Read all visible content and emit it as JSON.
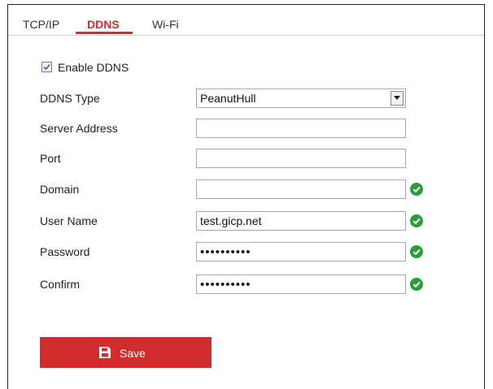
{
  "tabs": [
    {
      "label": "TCP/IP",
      "active": false
    },
    {
      "label": "DDNS",
      "active": true
    },
    {
      "label": "Wi-Fi",
      "active": false
    }
  ],
  "form": {
    "enable_ddns": {
      "label": "Enable DDNS",
      "checked": true
    },
    "ddns_type": {
      "label": "DDNS Type",
      "value": "PeanutHull"
    },
    "server_address": {
      "label": "Server Address",
      "value": ""
    },
    "port": {
      "label": "Port",
      "value": ""
    },
    "domain": {
      "label": "Domain",
      "value": ""
    },
    "user_name": {
      "label": "User Name",
      "value": "test.gicp.net"
    },
    "password": {
      "label": "Password",
      "value": "••••••••••"
    },
    "confirm": {
      "label": "Confirm",
      "value": "••••••••••"
    }
  },
  "save_button": {
    "label": "Save"
  },
  "colors": {
    "accent": "#d22d2d",
    "valid": "#2a9d3c"
  },
  "icons": {
    "valid": "check-circle-icon",
    "save": "floppy-disk-icon",
    "dropdown": "chevron-down-icon"
  }
}
